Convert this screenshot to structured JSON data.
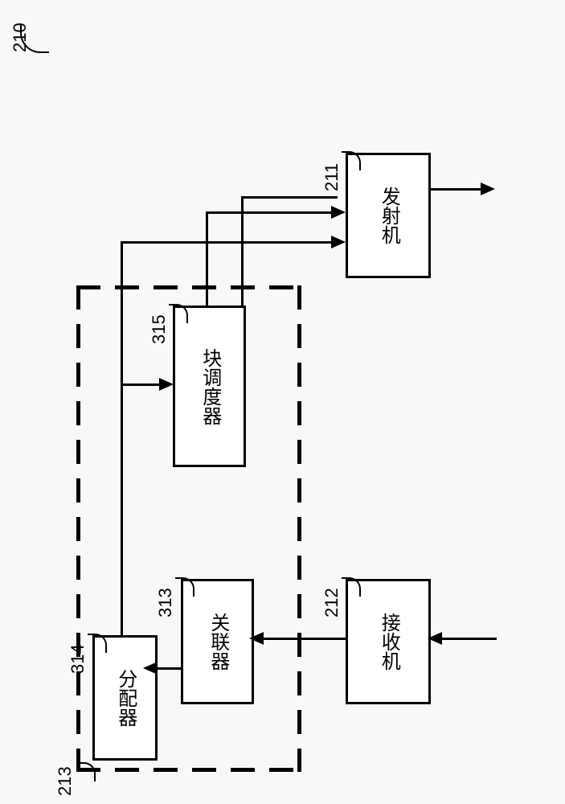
{
  "figure_ref": "210",
  "blocks": {
    "transmitter": {
      "label": "发射机",
      "ref": "211"
    },
    "receiver": {
      "label": "接收机",
      "ref": "212"
    },
    "block_scheduler": {
      "label": "块调度器",
      "ref": "315"
    },
    "correlator": {
      "label": "关联器",
      "ref": "313"
    },
    "allocator": {
      "label": "分配器",
      "ref": "314"
    }
  },
  "container_ref": "213"
}
